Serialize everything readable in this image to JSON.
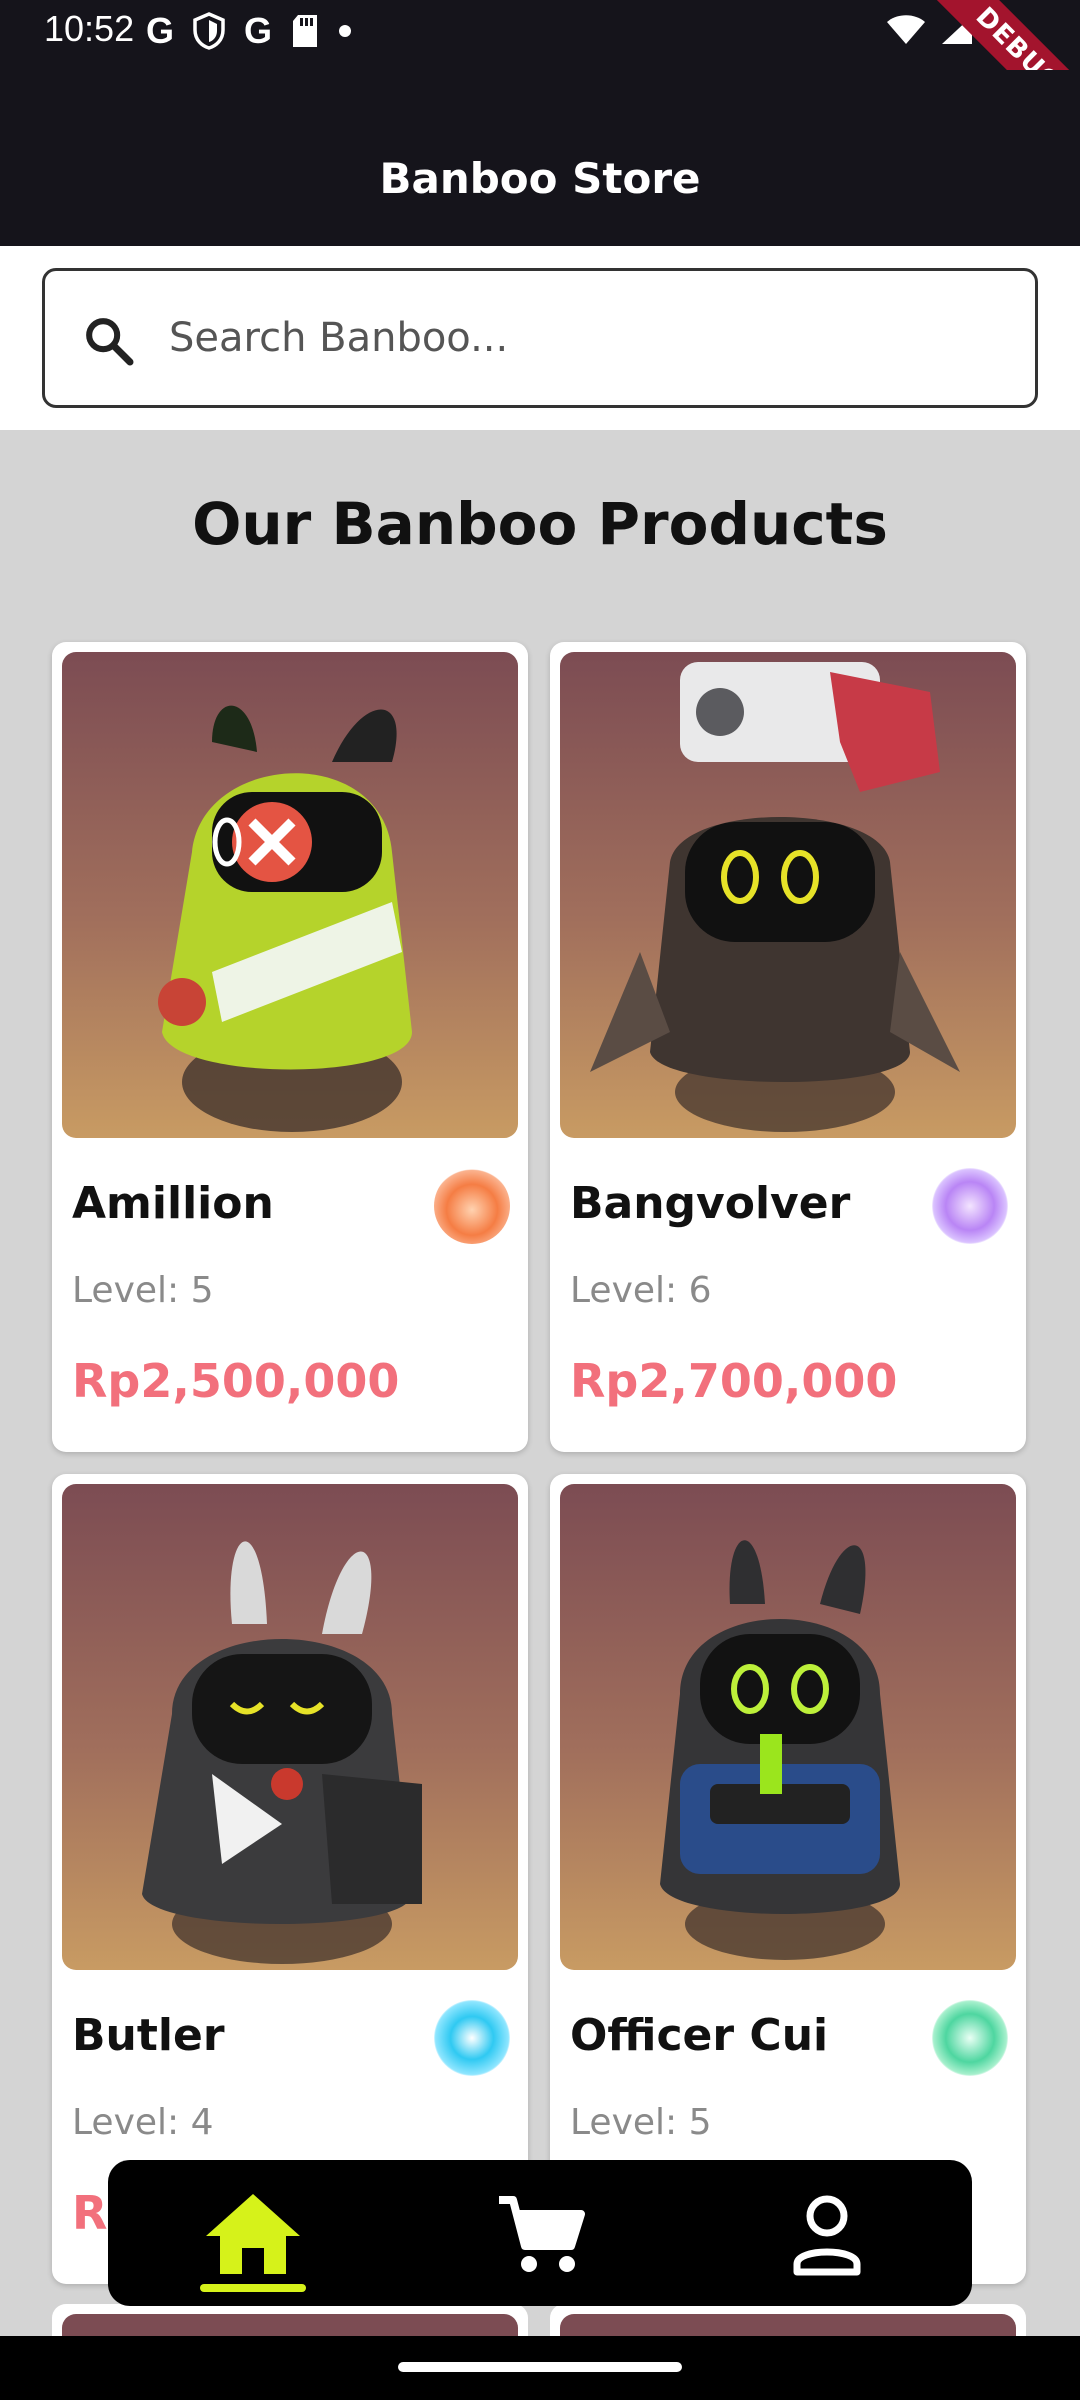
{
  "status_bar": {
    "time": "10:52",
    "left_icons": [
      "google-icon",
      "shield-icon",
      "google-icon",
      "sd-card-icon",
      "dot-icon"
    ],
    "right_icons": [
      "wifi-icon",
      "signal-icon",
      "battery-icon"
    ],
    "debug_label": "DEBUG"
  },
  "app_bar": {
    "title": "Banboo Store"
  },
  "search": {
    "placeholder": "Search Banboo...",
    "value": ""
  },
  "section_title": "Our Banboo Products",
  "products": [
    {
      "name": "Amillion",
      "level": "Level: 5",
      "price": "Rp2,500,000",
      "element_icon": "fire-element-icon"
    },
    {
      "name": "Bangvolver",
      "level": "Level: 6",
      "price": "Rp2,700,000",
      "element_icon": "ether-element-icon"
    },
    {
      "name": "Butler",
      "level": "Level: 4",
      "price": "Rp",
      "element_icon": "ice-element-icon"
    },
    {
      "name": "Officer Cui",
      "level": "Level: 5",
      "price": "",
      "element_icon": "physical-element-icon"
    }
  ],
  "bottom_nav": {
    "items": [
      {
        "icon": "home-icon",
        "active": true
      },
      {
        "icon": "cart-icon",
        "active": false
      },
      {
        "icon": "profile-icon",
        "active": false
      }
    ],
    "active_color": "#d6f21a"
  },
  "colors": {
    "app_bar_bg": "#15141b",
    "price": "#f2707c",
    "page_bg": "#d4d4d4",
    "debug_ribbon": "#a3142d"
  }
}
